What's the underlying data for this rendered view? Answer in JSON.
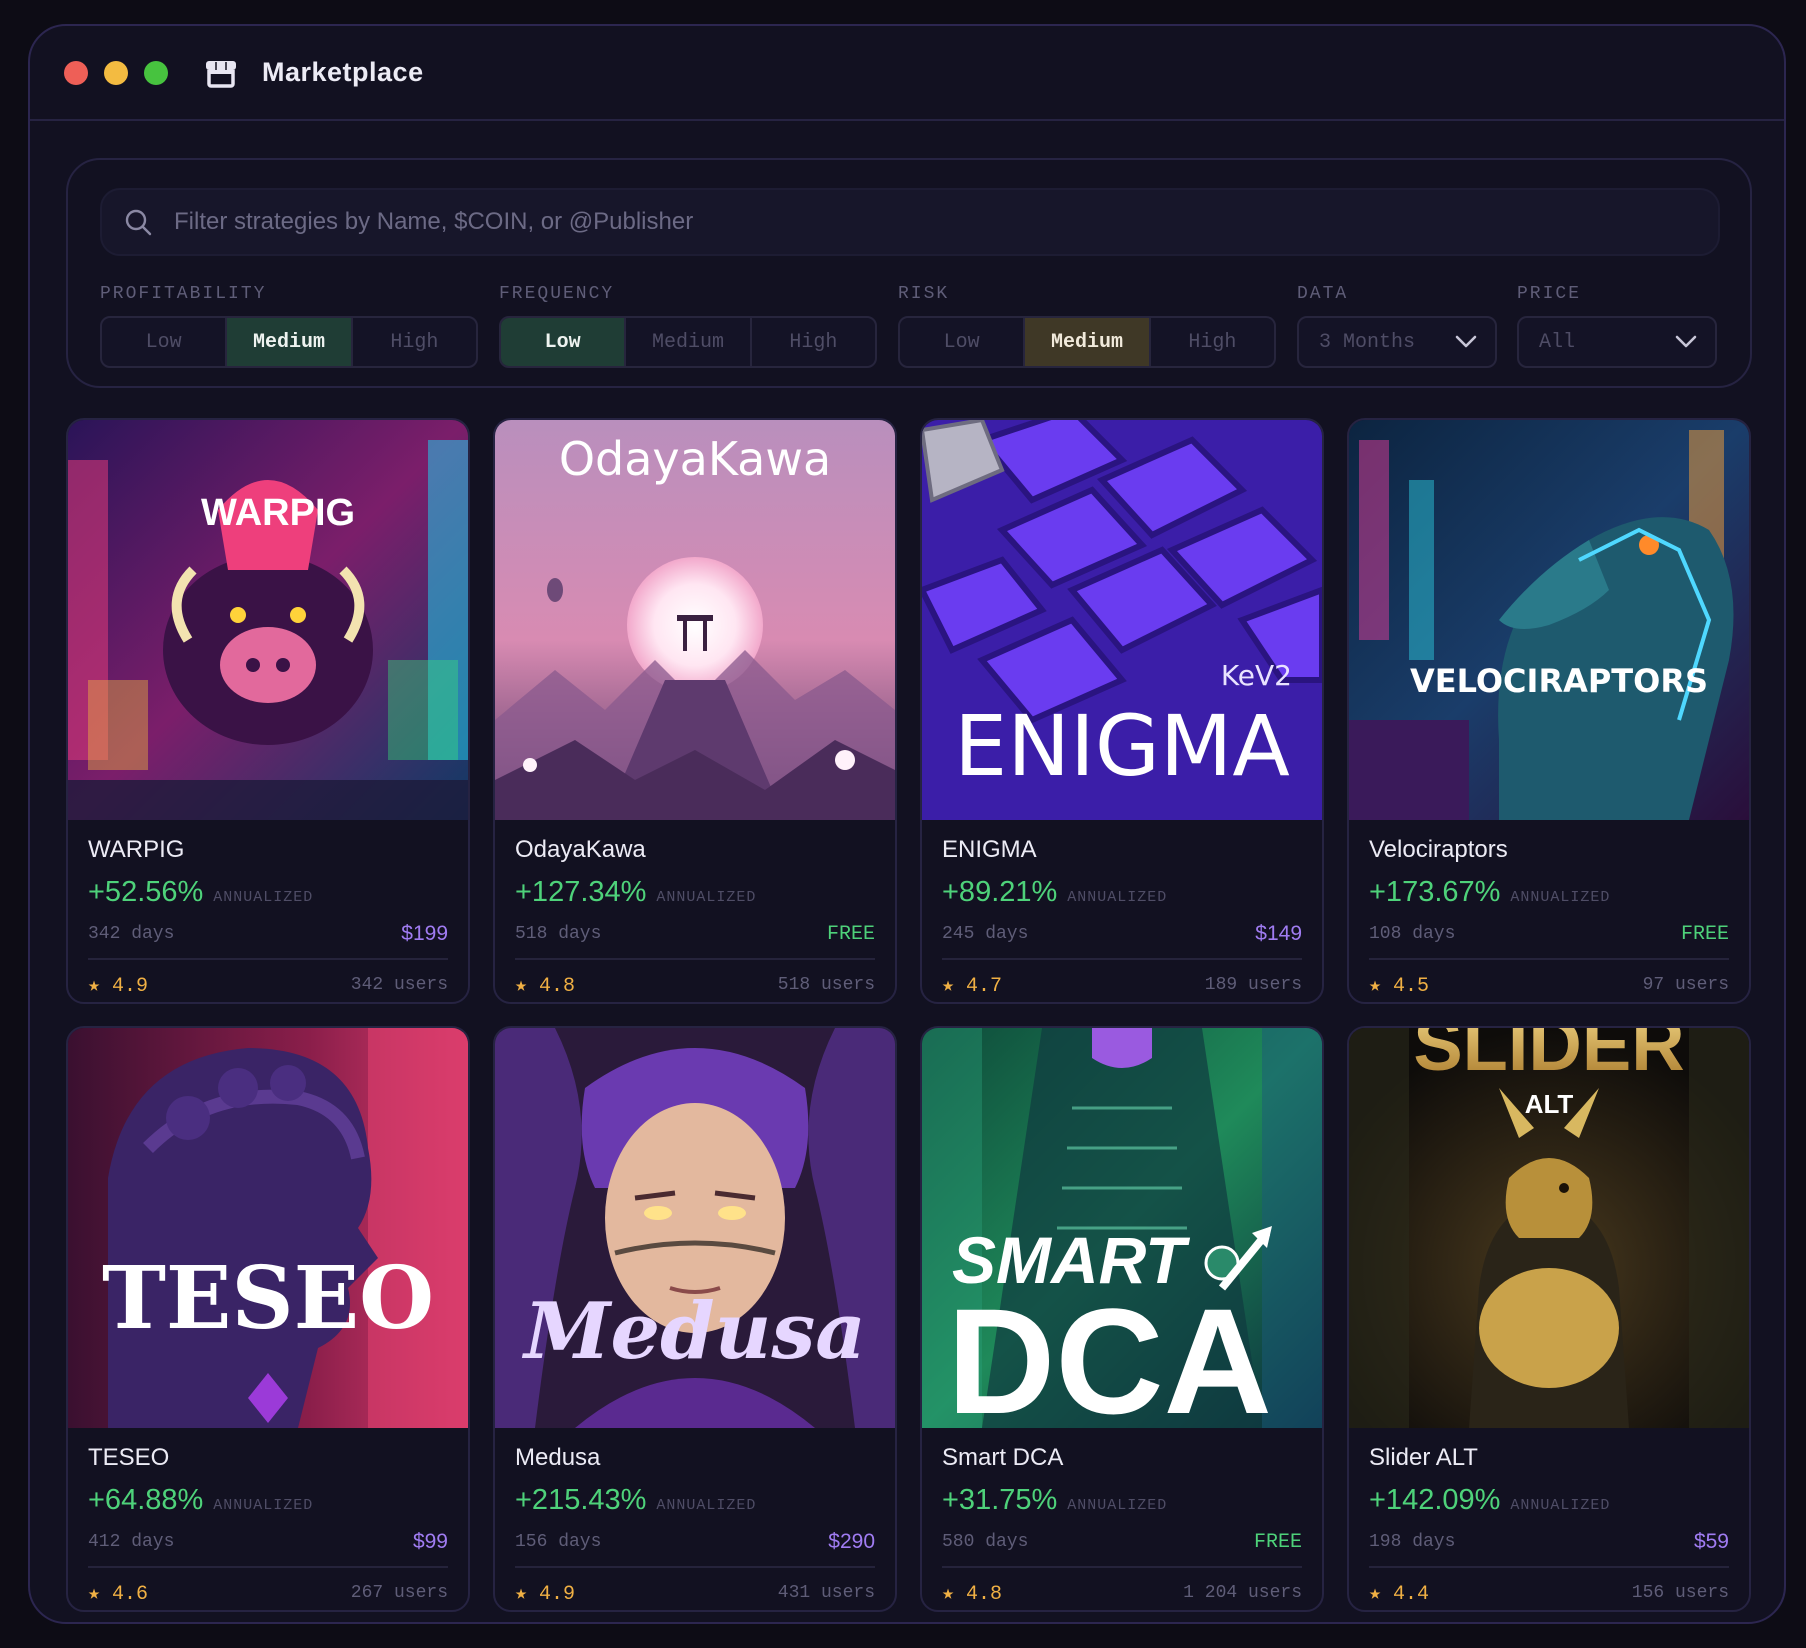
{
  "window": {
    "title": "Marketplace"
  },
  "search": {
    "placeholder": "Filter strategies by Name, $COIN, or @Publisher"
  },
  "filters": {
    "profitability": {
      "label": "PROFITABILITY",
      "options": [
        "Low",
        "Medium",
        "High"
      ],
      "selected": "Medium"
    },
    "frequency": {
      "label": "FREQUENCY",
      "options": [
        "Low",
        "Medium",
        "High"
      ],
      "selected": "Low"
    },
    "risk": {
      "label": "RISK",
      "options": [
        "Low",
        "Medium",
        "High"
      ],
      "selected": "Medium"
    },
    "data": {
      "label": "DATA",
      "value": "3 Months"
    },
    "price": {
      "label": "PRICE",
      "value": "All"
    }
  },
  "annualized_label": "ANNUALIZED",
  "cards": [
    {
      "name": "WARPIG",
      "art_title": "WARPIG",
      "gain": "+52.56%",
      "days": "342 days",
      "price": "$199",
      "free": false,
      "rating": "★ 4.9",
      "users": "342 users"
    },
    {
      "name": "OdayaKawa",
      "art_title": "OdayaKawa",
      "gain": "+127.34%",
      "days": "518 days",
      "price": "FREE",
      "free": true,
      "rating": "★ 4.8",
      "users": "518 users"
    },
    {
      "name": "ENIGMA",
      "art_title": "ENIGMA",
      "art_subtitle": "KeV2",
      "gain": "+89.21%",
      "days": "245 days",
      "price": "$149",
      "free": false,
      "rating": "★ 4.7",
      "users": "189 users"
    },
    {
      "name": "Velociraptors",
      "art_title": "VELOCIRAPTORS",
      "gain": "+173.67%",
      "days": "108 days",
      "price": "FREE",
      "free": true,
      "rating": "★ 4.5",
      "users": "97 users"
    },
    {
      "name": "TESEO",
      "art_title": "TESEO",
      "gain": "+64.88%",
      "days": "412 days",
      "price": "$99",
      "free": false,
      "rating": "★ 4.6",
      "users": "267 users"
    },
    {
      "name": "Medusa",
      "art_title": "Medusa",
      "gain": "+215.43%",
      "days": "156 days",
      "price": "$290",
      "free": false,
      "rating": "★ 4.9",
      "users": "431 users"
    },
    {
      "name": "Smart DCA",
      "art_title": "SMART",
      "art_subtitle": "DCA",
      "gain": "+31.75%",
      "days": "580 days",
      "price": "FREE",
      "free": true,
      "rating": "★ 4.8",
      "users": "1 204 users"
    },
    {
      "name": "Slider ALT",
      "art_title": "SLIDER",
      "art_subtitle": "ALT",
      "gain": "+142.09%",
      "days": "198 days",
      "price": "$59",
      "free": false,
      "rating": "★ 4.4",
      "users": "156 users"
    }
  ],
  "colors": {
    "gain": "#4ed27a",
    "price": "#a07cf2",
    "rating": "#f0b044",
    "accent_border": "#2c2650"
  }
}
